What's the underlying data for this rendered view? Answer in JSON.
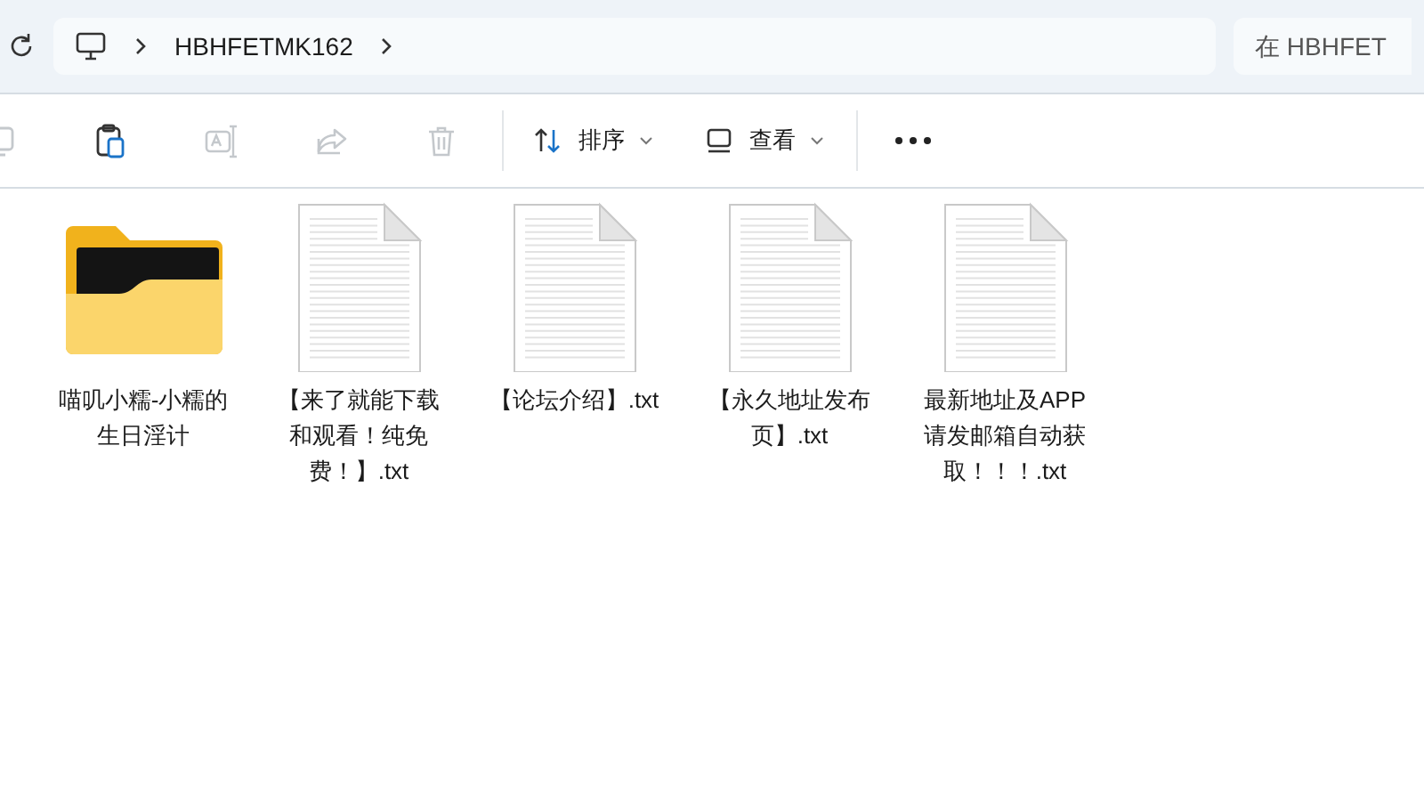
{
  "address_bar": {
    "crumbs": [
      "HBHFETMK162"
    ]
  },
  "search": {
    "placeholder": "在 HBHFET"
  },
  "toolbar": {
    "icon_buttons": [
      {
        "kind": "copy",
        "disabled": true
      },
      {
        "kind": "paste",
        "disabled": false
      },
      {
        "kind": "rename",
        "disabled": true
      },
      {
        "kind": "share",
        "disabled": true
      },
      {
        "kind": "delete",
        "disabled": true
      }
    ],
    "sort": {
      "label": "排序"
    },
    "view": {
      "label": "查看"
    }
  },
  "files": [
    {
      "kind": "folder",
      "name": "喵叽小糯-小糯的生日淫计"
    },
    {
      "kind": "text",
      "name": "【来了就能下载和观看！纯免费！】.txt"
    },
    {
      "kind": "text",
      "name": "【论坛介绍】.txt"
    },
    {
      "kind": "text",
      "name": "【永久地址发布页】.txt"
    },
    {
      "kind": "text",
      "name": "最新地址及APP请发邮箱自动获取！！！.txt"
    }
  ]
}
